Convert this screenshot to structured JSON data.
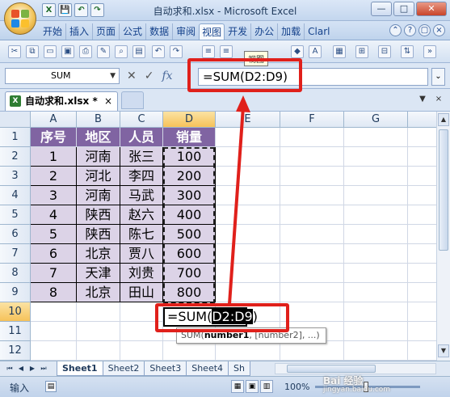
{
  "window": {
    "title": "自动求和.xlsx - Microsoft Excel",
    "controls": [
      "—",
      "□",
      "✕"
    ]
  },
  "quick_access": [
    "X",
    "💾",
    "↶",
    "↷"
  ],
  "ribbon": {
    "tabs": [
      "开始",
      "插入",
      "页面",
      "公式",
      "数据",
      "审阅",
      "视图",
      "开发",
      "办公",
      "加载",
      "Clarl"
    ],
    "active_tab": "视图",
    "tooltip": "视图"
  },
  "formula_bar": {
    "name_box": "SUM",
    "cancel": "✕",
    "enter": "✓",
    "fx": "fx",
    "formula": "=SUM(D2:D9)"
  },
  "workbook": {
    "tab_label": "自动求和.xlsx *",
    "close": "×"
  },
  "sheet": {
    "columns": [
      "A",
      "B",
      "C",
      "D",
      "E",
      "F",
      "G"
    ],
    "rows": [
      "1",
      "2",
      "3",
      "4",
      "5",
      "6",
      "7",
      "8",
      "9",
      "10",
      "11",
      "12"
    ],
    "headers": [
      "序号",
      "地区",
      "人员",
      "销量"
    ],
    "data": [
      [
        "1",
        "河南",
        "张三",
        "100"
      ],
      [
        "2",
        "河北",
        "李四",
        "200"
      ],
      [
        "3",
        "河南",
        "马武",
        "300"
      ],
      [
        "4",
        "陕西",
        "赵六",
        "400"
      ],
      [
        "5",
        "陕西",
        "陈七",
        "500"
      ],
      [
        "6",
        "北京",
        "贾八",
        "600"
      ],
      [
        "7",
        "天津",
        "刘贵",
        "700"
      ],
      [
        "8",
        "北京",
        "田山",
        "800"
      ]
    ],
    "edit_cell_prefix": "=SUM(",
    "edit_cell_ref": "D2:D9",
    "edit_cell_suffix": ")",
    "fn_tooltip_name": "SUM(",
    "fn_tooltip_arg1": "number1",
    "fn_tooltip_rest": ", [number2], ...)"
  },
  "sheet_tabs": [
    "Sheet1",
    "Sheet2",
    "Sheet3",
    "Sheet4",
    "Sh"
  ],
  "active_sheet": "Sheet1",
  "status": {
    "mode": "输入",
    "zoom": "100%"
  },
  "watermark": {
    "brand": "Bai 经验",
    "url": "jingyan.baidu.com"
  },
  "colors": {
    "header_fill": "#8064a2",
    "data_fill": "#dcd3e7",
    "annotation": "#e0201b"
  }
}
